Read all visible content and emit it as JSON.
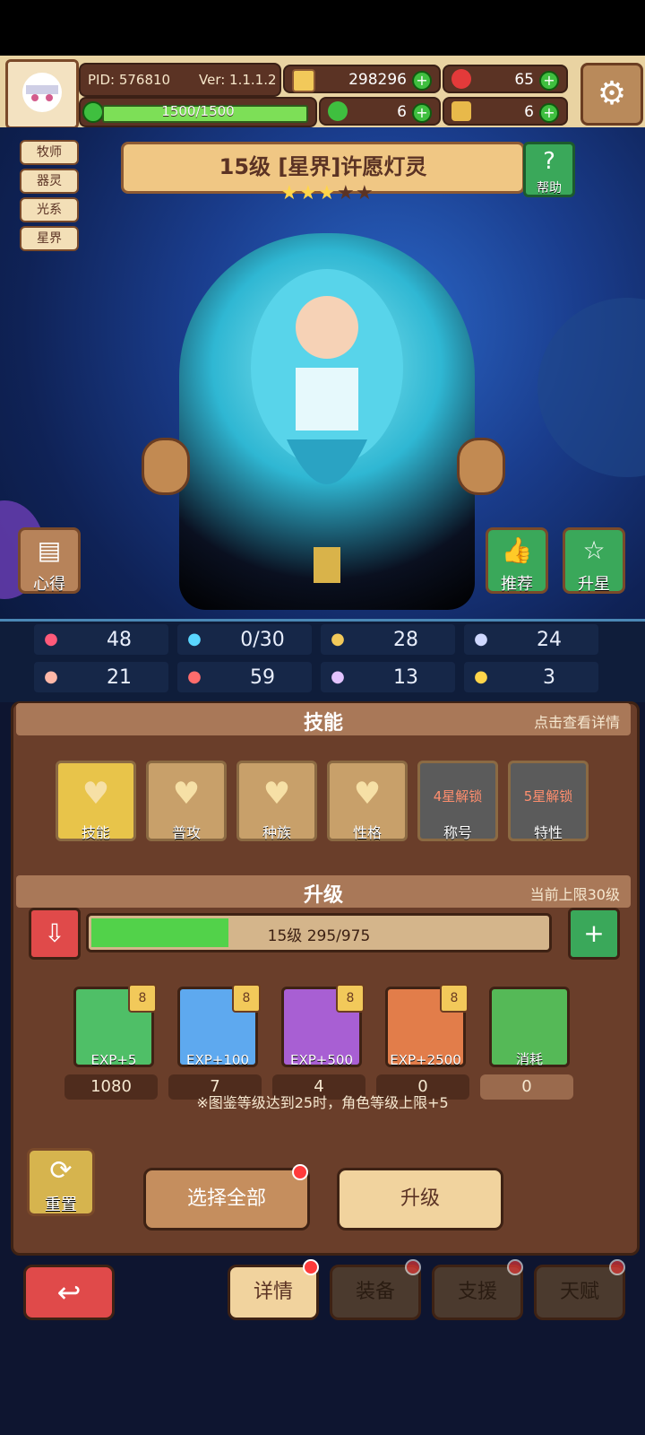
{
  "header": {
    "pid": "PID: 576810",
    "version": "Ver: 1.1.1.2",
    "hp_text": "1500/1500",
    "gold": "298296",
    "gems": "65",
    "clover": "6",
    "arm": "6"
  },
  "hero": {
    "title": "15级  [星界]许愿灯灵",
    "stars_filled": 3,
    "stars_total": 5,
    "tags": [
      "牧师",
      "器灵",
      "光系",
      "星界"
    ]
  },
  "buttons": {
    "help": "帮助",
    "insights": "心得",
    "recommend": "推荐",
    "star_up": "升星"
  },
  "stats": [
    {
      "icon": "heart-icon",
      "value": "48",
      "color": "#ff5a7a"
    },
    {
      "icon": "drop-icon",
      "value": "0/30",
      "color": "#5ad6ff"
    },
    {
      "icon": "shield-icon",
      "value": "28",
      "color": "#f2c95a"
    },
    {
      "icon": "wing-icon",
      "value": "24",
      "color": "#cfd8ff"
    },
    {
      "icon": "fist-icon",
      "value": "21",
      "color": "#ffb8a8"
    },
    {
      "icon": "book-icon",
      "value": "59",
      "color": "#ff6c6c"
    },
    {
      "icon": "boot-icon",
      "value": "13",
      "color": "#e2c3ff"
    },
    {
      "icon": "horseshoe-icon",
      "value": "3",
      "color": "#ffd54a"
    }
  ],
  "skills": {
    "title": "技能",
    "hint": "点击查看详情",
    "items": [
      {
        "label": "技能",
        "locked": "",
        "color": "#e8c44a"
      },
      {
        "label": "普攻",
        "locked": "",
        "color": "#c8a06a"
      },
      {
        "label": "种族",
        "locked": "",
        "color": "#c8a06a"
      },
      {
        "label": "性格",
        "locked": "",
        "color": "#c8a06a"
      },
      {
        "label": "称号",
        "locked": "4星解锁",
        "color": "#5b5b5b"
      },
      {
        "label": "特性",
        "locked": "5星解锁",
        "color": "#5b5b5b"
      }
    ]
  },
  "upgrade": {
    "title": "升级",
    "cap": "当前上限30级",
    "level_text": "15级  295/975",
    "progress": 0.302,
    "items": [
      {
        "exp": "EXP+5",
        "count": "1080",
        "color": "#4fbf67",
        "badge": "8"
      },
      {
        "exp": "EXP+100",
        "count": "7",
        "color": "#5ea9ef",
        "badge": "8"
      },
      {
        "exp": "EXP+500",
        "count": "4",
        "color": "#a85fd3",
        "badge": "8"
      },
      {
        "exp": "EXP+2500",
        "count": "0",
        "color": "#e27d4a",
        "badge": "8"
      },
      {
        "exp": "消耗",
        "count": "0",
        "color": "#55b957",
        "badge": ""
      }
    ],
    "note": "※图鉴等级达到25时，角色等级上限+5"
  },
  "actions": {
    "reset": "重置",
    "select_all": "选择全部",
    "upgrade": "升级"
  },
  "tabs": [
    "详情",
    "装备",
    "支援",
    "天赋"
  ]
}
